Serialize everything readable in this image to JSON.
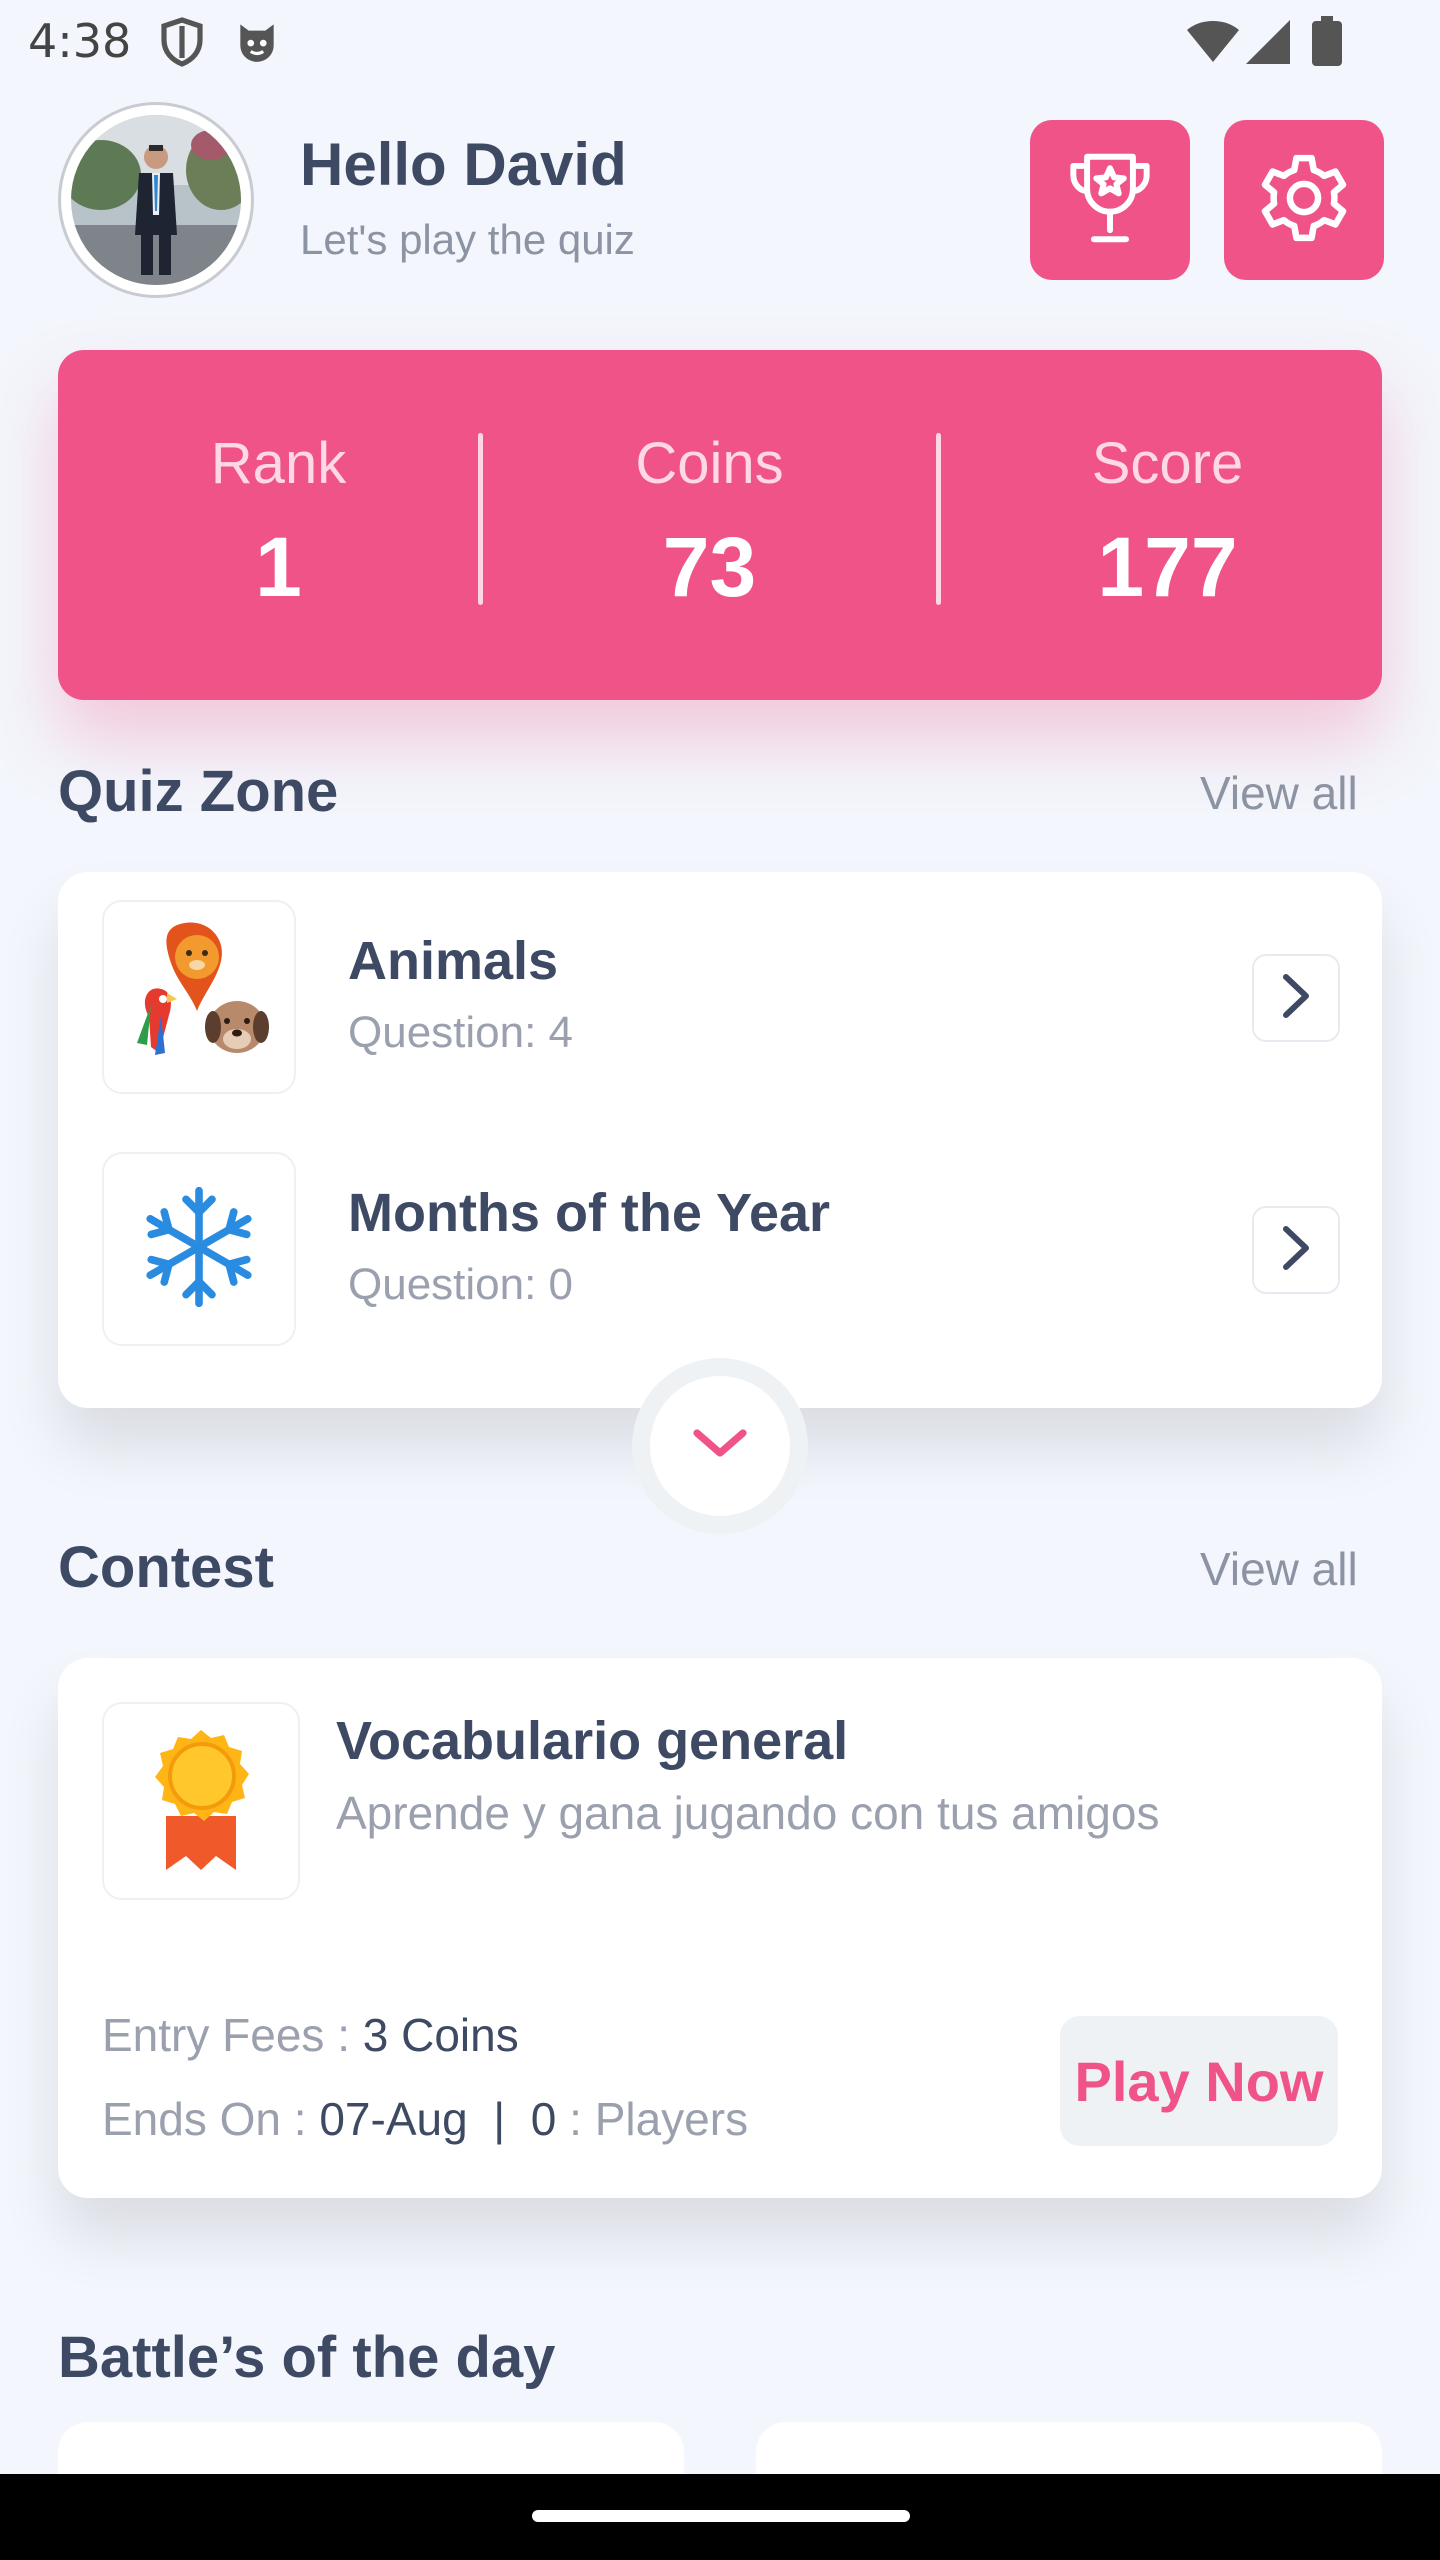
{
  "status_bar": {
    "time": "4:38",
    "icons": [
      "shield-icon",
      "cat-face-icon",
      "wifi-icon",
      "signal-icon",
      "battery-icon"
    ]
  },
  "header": {
    "greeting": "Hello David",
    "subtitle": "Let's play the quiz",
    "buttons": [
      "trophy-icon",
      "gear-icon"
    ]
  },
  "stats": {
    "rank_label": "Rank",
    "rank_value": "1",
    "coins_label": "Coins",
    "coins_value": "73",
    "score_label": "Score",
    "score_value": "177"
  },
  "quiz_zone": {
    "title": "Quiz Zone",
    "view_all": "View all",
    "items": [
      {
        "title": "Animals",
        "subtitle": "Question: 4",
        "icon": "animals-icon"
      },
      {
        "title": "Months of the Year",
        "subtitle": "Question: 0",
        "icon": "snowflake-icon"
      }
    ]
  },
  "contest": {
    "title": "Contest",
    "view_all": "View all",
    "card": {
      "title": "Vocabulario general",
      "description": "Aprende y gana jugando con tus amigos",
      "entry_fees_label": "Entry Fees : ",
      "entry_fees_value": "3 Coins",
      "ends_on_label": "Ends On : ",
      "ends_on_value": "07-Aug",
      "separator": "|",
      "players_count": "0",
      "players_label": " : Players",
      "play_button": "Play Now"
    }
  },
  "battles": {
    "title": "Battle’s of the day"
  },
  "colors": {
    "accent": "#EF5388",
    "background": "#F3F6FC",
    "text_primary": "#3E4A63",
    "text_secondary": "#9AA0AE"
  }
}
